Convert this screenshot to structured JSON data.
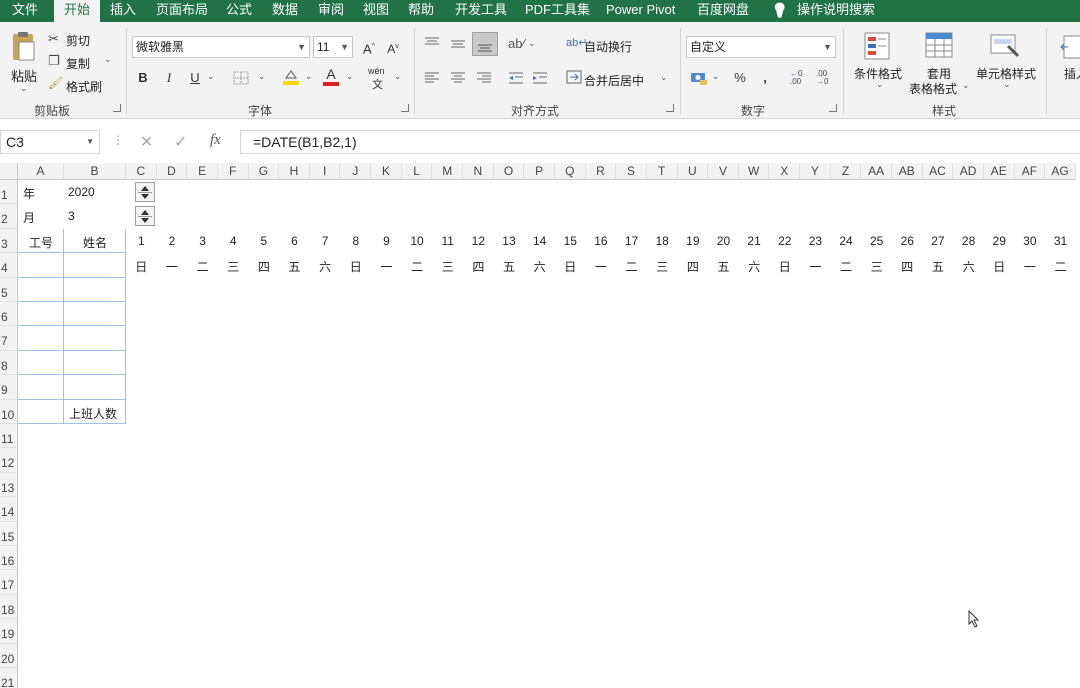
{
  "tabs": [
    "文件",
    "开始",
    "插入",
    "页面布局",
    "公式",
    "数据",
    "审阅",
    "视图",
    "帮助",
    "开发工具",
    "PDF工具集",
    "Power Pivot",
    "百度网盘",
    "操作说明搜索"
  ],
  "clipboard": {
    "paste": "粘贴",
    "cut": "剪切",
    "copy": "复制",
    "format_painter": "格式刷",
    "group": "剪贴板"
  },
  "font": {
    "name": "微软雅黑",
    "size": "11",
    "group": "字体",
    "bold": "B",
    "italic": "I",
    "underline": "U",
    "grow": "A",
    "shrink": "A",
    "color": "A",
    "phonetic": "wén"
  },
  "alignment": {
    "wrap": "自动换行",
    "merge": "合并后居中",
    "group": "对齐方式"
  },
  "number": {
    "format": "自定义",
    "percent": "%",
    "comma": ",",
    "inc": ".00",
    "dec": ".00",
    "group": "数字"
  },
  "styles": {
    "cond": "条件格式",
    "table1": "套用",
    "table2": "表格格式",
    "cell": "单元格样式",
    "insert": "插入",
    "group": "样式"
  },
  "formula": {
    "namebox": "C3",
    "fx": "fx",
    "cancel": "✕",
    "enter": "✓",
    "content": "=DATE(B1,B2,1)"
  },
  "columns": [
    "A",
    "B",
    "C",
    "D",
    "E",
    "F",
    "G",
    "H",
    "I",
    "J",
    "K",
    "L",
    "M",
    "N",
    "O",
    "P",
    "Q",
    "R",
    "S",
    "T",
    "U",
    "V",
    "W",
    "X",
    "Y",
    "Z",
    "AA",
    "AB",
    "AC",
    "AD",
    "AE",
    "AF",
    "AG"
  ],
  "rows": [
    "1",
    "2",
    "3",
    "4",
    "5",
    "6",
    "7",
    "8",
    "9",
    "10",
    "11",
    "12",
    "13",
    "14",
    "15",
    "16",
    "17",
    "18",
    "19",
    "20",
    "21"
  ],
  "cells": {
    "a1": "年",
    "b1": "2020",
    "a2": "月",
    "b2": "3",
    "a3": "工号",
    "b3": "姓名",
    "b10": "上班人数"
  },
  "days": [
    "1",
    "2",
    "3",
    "4",
    "5",
    "6",
    "7",
    "8",
    "9",
    "10",
    "11",
    "12",
    "13",
    "14",
    "15",
    "16",
    "17",
    "18",
    "19",
    "20",
    "21",
    "22",
    "23",
    "24",
    "25",
    "26",
    "27",
    "28",
    "29",
    "30",
    "31"
  ],
  "weekdays": [
    "日",
    "一",
    "二",
    "三",
    "四",
    "五",
    "六",
    "日",
    "一",
    "二",
    "三",
    "四",
    "五",
    "六",
    "日",
    "一",
    "二",
    "三",
    "四",
    "五",
    "六",
    "日",
    "一",
    "二",
    "三",
    "四",
    "五",
    "六",
    "日",
    "一",
    "二"
  ],
  "colors": {
    "accent": "#217346",
    "border": "#9cc2e5"
  }
}
